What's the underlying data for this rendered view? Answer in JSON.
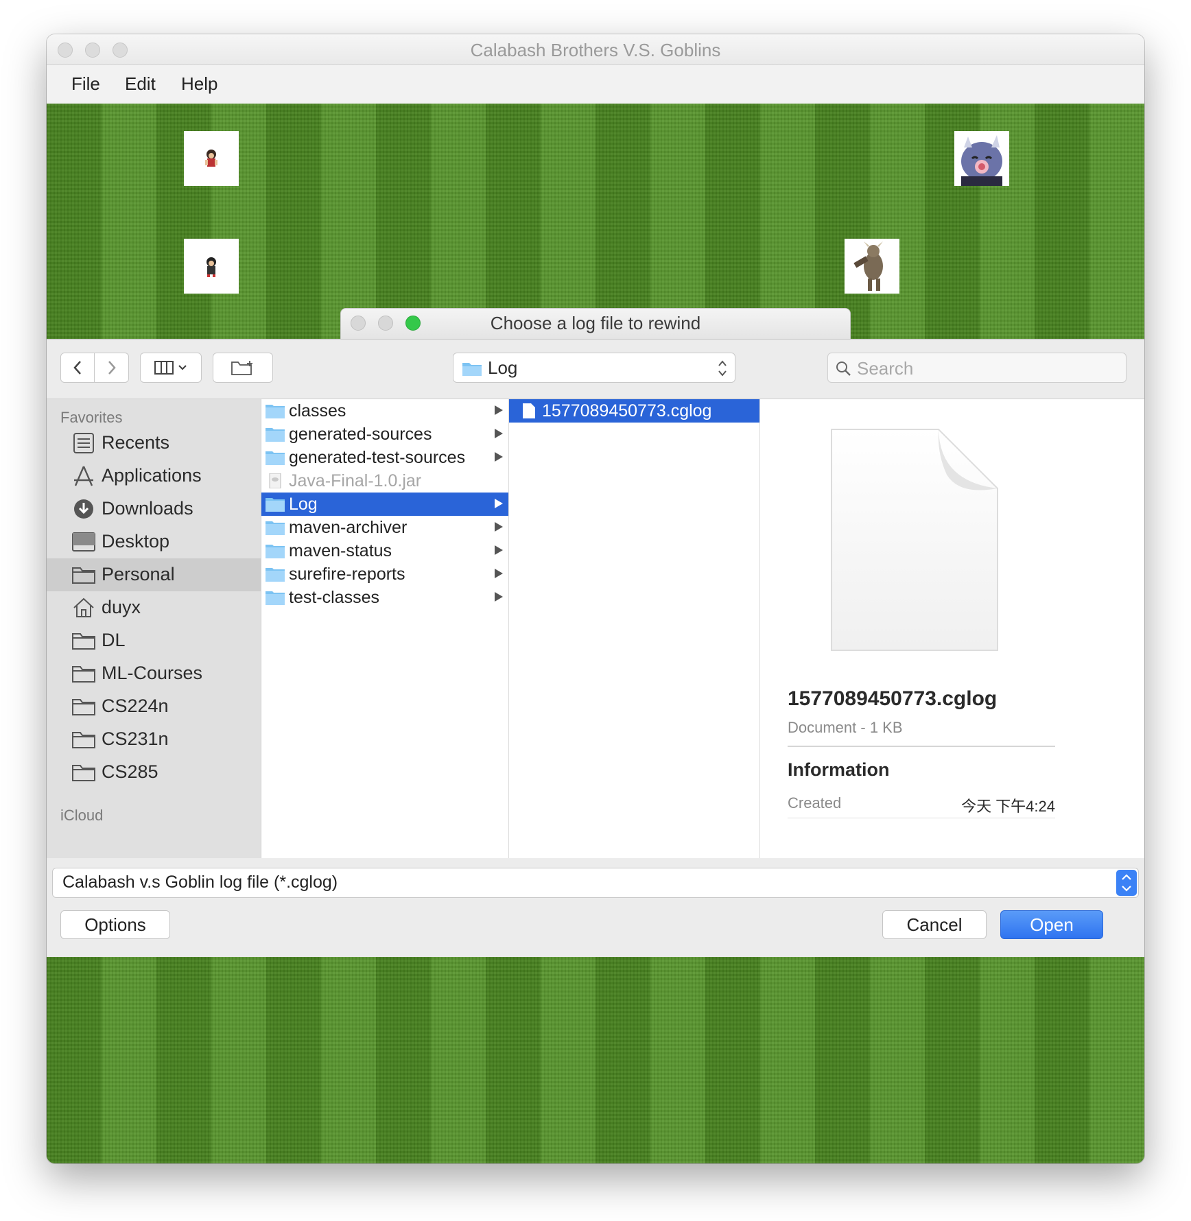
{
  "window": {
    "title": "Calabash Brothers V.S. Goblins"
  },
  "menubar": {
    "items": [
      "File",
      "Edit",
      "Help"
    ]
  },
  "dialog": {
    "title": "Choose a log file to rewind",
    "toolbar": {
      "location": "Log",
      "search_placeholder": "Search"
    },
    "sidebar": {
      "favorites_heading": "Favorites",
      "items": [
        {
          "label": "Recents",
          "icon": "recents-icon"
        },
        {
          "label": "Applications",
          "icon": "applications-icon"
        },
        {
          "label": "Downloads",
          "icon": "downloads-icon"
        },
        {
          "label": "Desktop",
          "icon": "desktop-icon"
        },
        {
          "label": "Personal",
          "icon": "folder-icon",
          "selected": true
        },
        {
          "label": "duyx",
          "icon": "home-icon"
        },
        {
          "label": "DL",
          "icon": "folder-icon"
        },
        {
          "label": "ML-Courses",
          "icon": "folder-icon"
        },
        {
          "label": "CS224n",
          "icon": "folder-icon"
        },
        {
          "label": "CS231n",
          "icon": "folder-icon"
        },
        {
          "label": "CS285",
          "icon": "folder-icon"
        }
      ],
      "icloud_heading": "iCloud"
    },
    "column1": [
      {
        "label": "classes",
        "type": "folder"
      },
      {
        "label": "generated-sources",
        "type": "folder"
      },
      {
        "label": "generated-test-sources",
        "type": "folder"
      },
      {
        "label": "Java-Final-1.0.jar",
        "type": "jar"
      },
      {
        "label": "Log",
        "type": "folder",
        "selected": true
      },
      {
        "label": "maven-archiver",
        "type": "folder"
      },
      {
        "label": "maven-status",
        "type": "folder"
      },
      {
        "label": "surefire-reports",
        "type": "folder"
      },
      {
        "label": "test-classes",
        "type": "folder"
      }
    ],
    "column2": [
      {
        "label": "1577089450773.cglog",
        "type": "document",
        "selected": true
      }
    ],
    "preview": {
      "filename": "1577089450773.cglog",
      "kind_size": "Document - 1 KB",
      "info_heading": "Information",
      "created_label": "Created",
      "created_value": "今天 下午4:24"
    },
    "format": "Calabash v.s Goblin log file (*.cglog)",
    "buttons": {
      "options": "Options",
      "cancel": "Cancel",
      "open": "Open"
    }
  },
  "colors": {
    "accent": "#2a64d8",
    "field": "#4f8f22",
    "open_button": "#3b82f6"
  }
}
